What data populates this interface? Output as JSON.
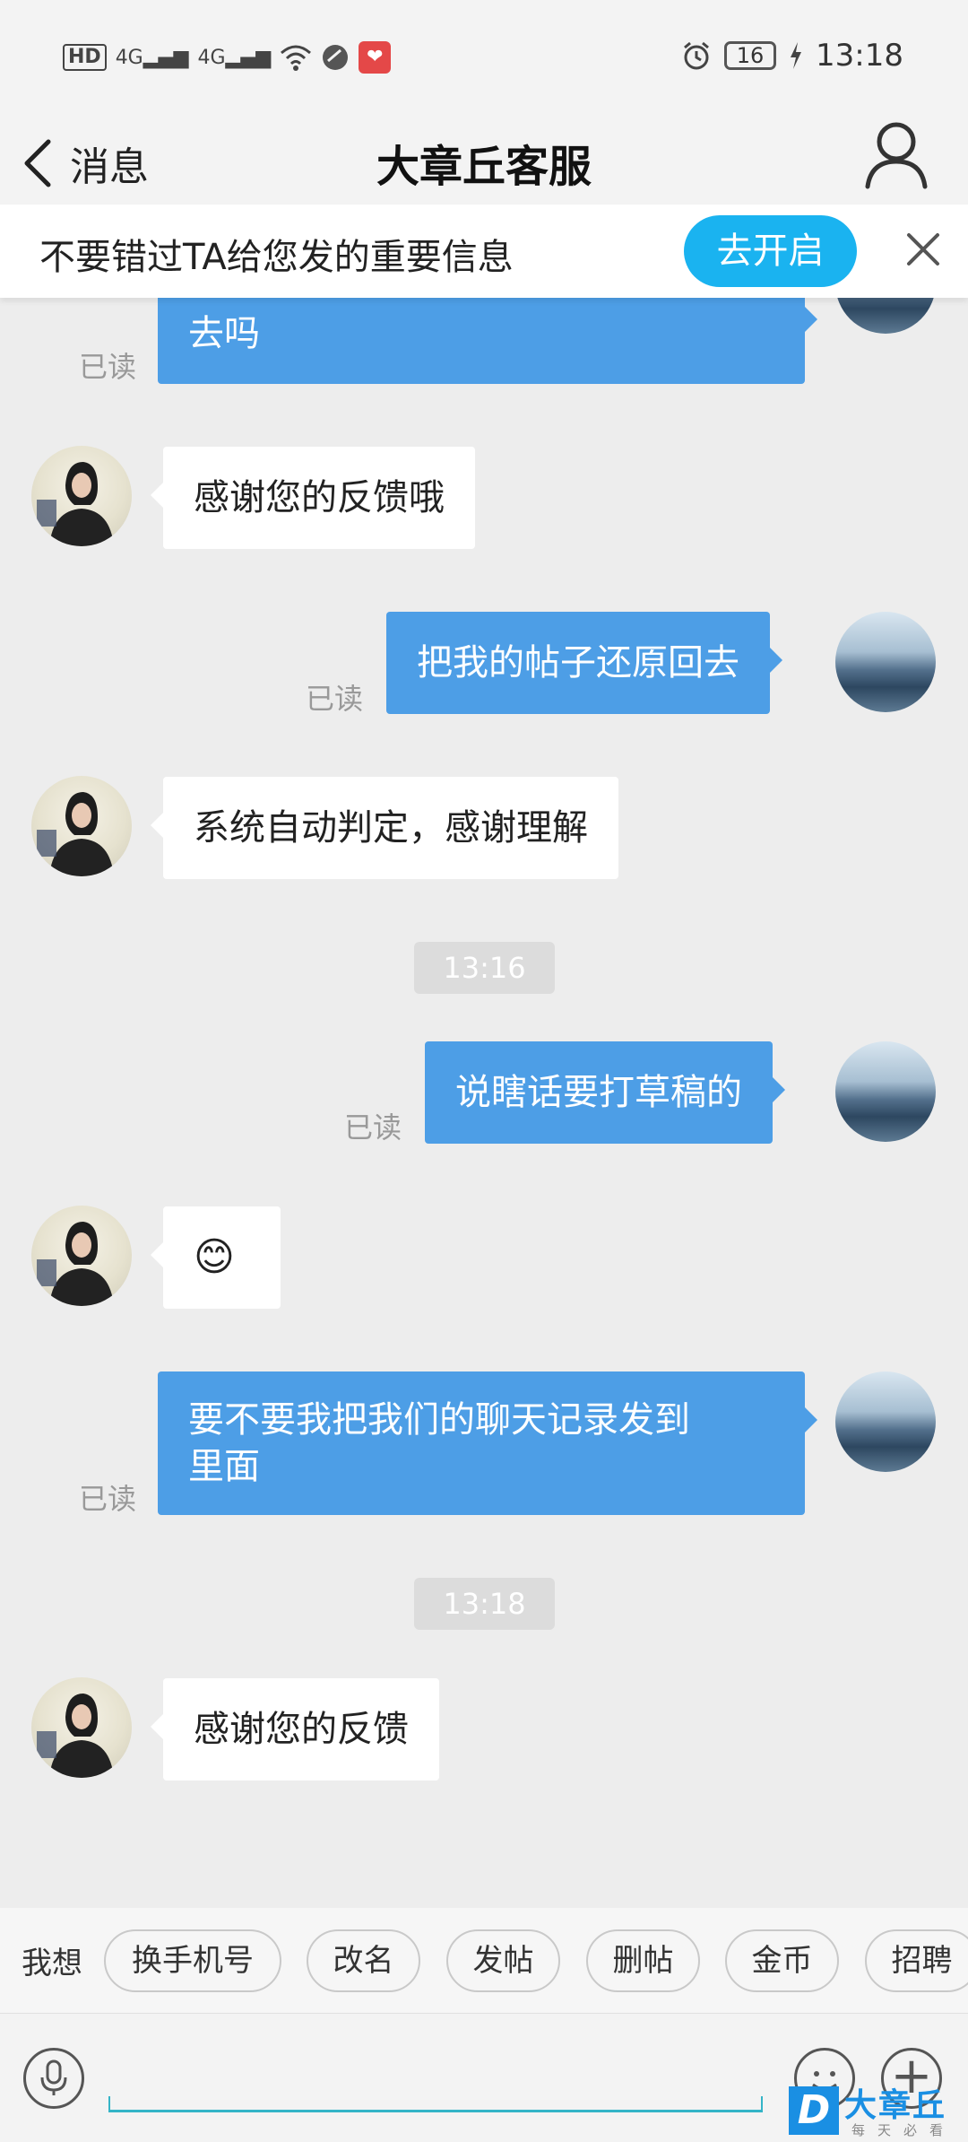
{
  "status_bar": {
    "hd_label": "HD",
    "net1": "4G",
    "net2": "4G",
    "battery": "16",
    "time": "13:18"
  },
  "header": {
    "back_label": "消息",
    "title": "大章丘客服"
  },
  "banner": {
    "text": "不要错过TA给您发的重要信息",
    "button_label": "去开启"
  },
  "messages": [
    {
      "side": "out",
      "text": "去吗",
      "read": "已读"
    },
    {
      "side": "in",
      "text": "感谢您的反馈哦"
    },
    {
      "side": "out",
      "text": "把我的帖子还原回去",
      "read": "已读"
    },
    {
      "side": "in",
      "text": "系统自动判定，感谢理解"
    },
    {
      "side": "time",
      "text": "13:16"
    },
    {
      "side": "out",
      "text": "说瞎话要打草稿的",
      "read": "已读"
    },
    {
      "side": "in",
      "text": "😊"
    },
    {
      "side": "out",
      "text_line1": "要不要我把我们的聊天记录发到",
      "text_line2": "里面",
      "read": "已读"
    },
    {
      "side": "time",
      "text": "13:18"
    },
    {
      "side": "in",
      "text": "感谢您的反馈"
    }
  ],
  "quick_replies": {
    "label": "我想",
    "items": [
      "换手机号",
      "改名",
      "发帖",
      "删帖",
      "金币",
      "招聘"
    ]
  },
  "watermark": {
    "logo_letter": "D",
    "brand": "大章丘",
    "slogan": "每天必看"
  },
  "colors": {
    "outgoing_bubble": "#4d9ee6",
    "banner_button": "#1ab3f0"
  }
}
